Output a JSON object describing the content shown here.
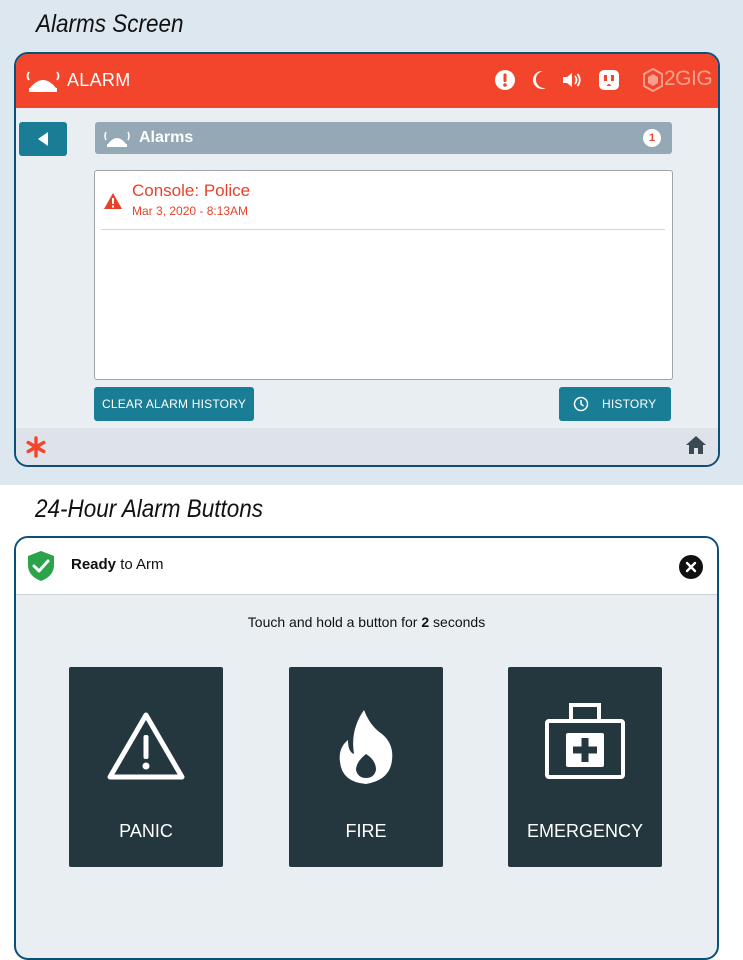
{
  "section1": {
    "title": "Alarms Screen"
  },
  "alarm_screen": {
    "header_title": "ALARM",
    "status_icons": [
      "alert-icon",
      "moon-icon",
      "speaker-icon",
      "outlet-icon"
    ],
    "brand": "2GIG",
    "alarms_label": "Alarms",
    "alarm_count": "1",
    "alarms": [
      {
        "name": "Console: Police",
        "time": "Mar 3, 2020 - 8:13AM"
      }
    ],
    "clear_button": "CLEAR ALARM HISTORY",
    "history_button": "HISTORY"
  },
  "section2": {
    "title": "24-Hour Alarm Buttons"
  },
  "arm_screen": {
    "ready_bold": "Ready",
    "ready_rest": " to Arm",
    "instruction_pre": "Touch and hold a button for ",
    "instruction_bold": "2",
    "instruction_post": " seconds",
    "tiles": [
      {
        "label": "PANIC",
        "icon": "warning-triangle-icon"
      },
      {
        "label": "FIRE",
        "icon": "flame-icon"
      },
      {
        "label": "EMERGENCY",
        "icon": "medical-kit-icon"
      }
    ]
  },
  "colors": {
    "header_red": "#f2452c",
    "teal": "#1a7d96",
    "tile_dark": "#24373f",
    "shield_green": "#2aa34a"
  }
}
